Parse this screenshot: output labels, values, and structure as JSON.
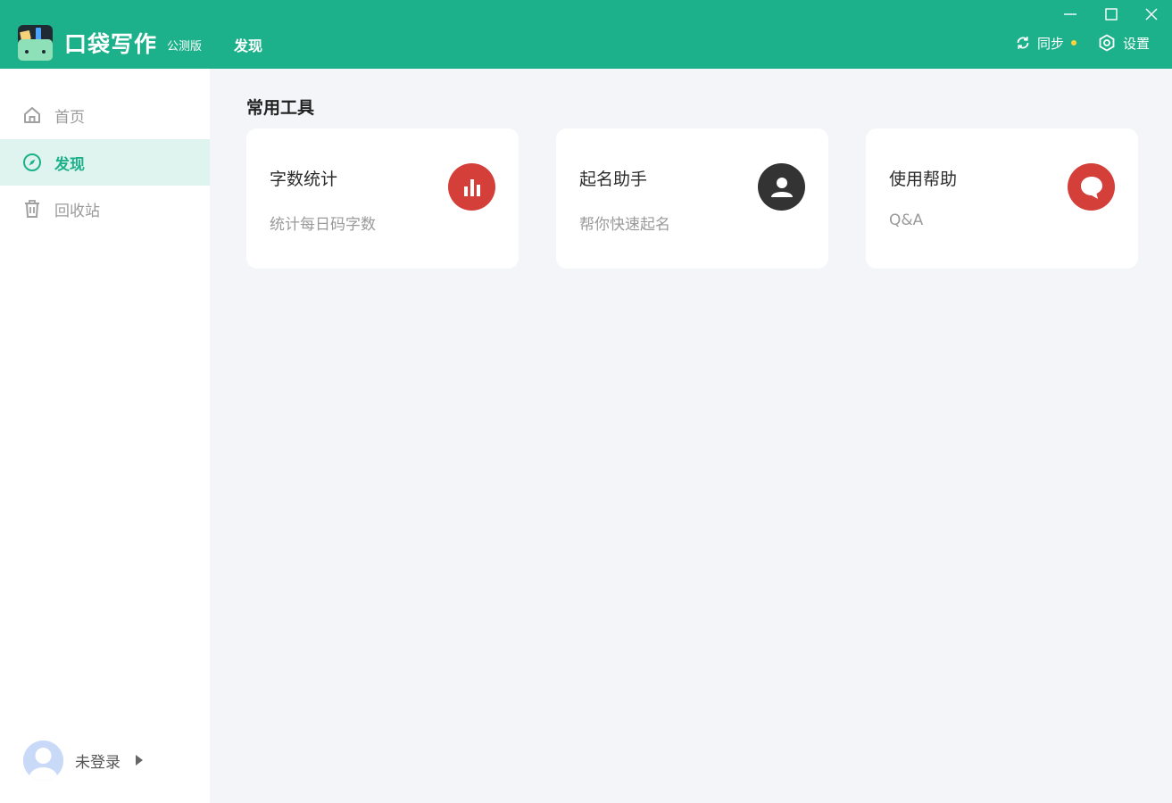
{
  "header": {
    "app_title": "口袋写作",
    "badge": "公测版",
    "nav_label": "发现",
    "sync_label": "同步",
    "settings_label": "设置",
    "accent_color": "#1cb18a",
    "sync_dot_color": "#ffd23e"
  },
  "sidebar": {
    "items": [
      {
        "label": "首页",
        "icon": "home-icon",
        "active": false
      },
      {
        "label": "发现",
        "icon": "compass-icon",
        "active": true
      },
      {
        "label": "回收站",
        "icon": "trash-icon",
        "active": false
      }
    ],
    "user_label": "未登录"
  },
  "main": {
    "section_title": "常用工具",
    "cards": [
      {
        "title": "字数统计",
        "subtitle": "统计每日码字数",
        "icon": "bar-chart-icon",
        "icon_color": "#d43f3a"
      },
      {
        "title": "起名助手",
        "subtitle": "帮你快速起名",
        "icon": "person-icon",
        "icon_color": "#333333"
      },
      {
        "title": "使用帮助",
        "subtitle": "Q&A",
        "icon": "speech-bubble-icon",
        "icon_color": "#d43f3a"
      }
    ]
  }
}
